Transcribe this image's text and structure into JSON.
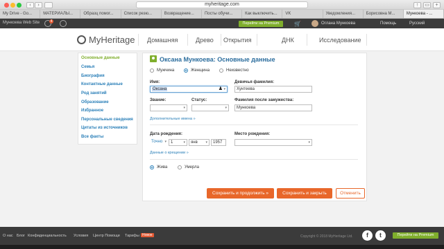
{
  "browser": {
    "url": "myheritage.com",
    "tabs": [
      "My Drive - Go...",
      "МАТЕРИАЛЫ...",
      "Образц помог...",
      "Список резю...",
      "Возвращение...",
      "Посты обучи...",
      "Как выключить...",
      "VK",
      "Уведомления...",
      "Борисовна М...",
      "Мункоева - ..."
    ]
  },
  "topbar": {
    "site_name": "Мункоева Web Site",
    "notif_count": "4",
    "premium_label": "Перейти на Premium",
    "user_name": "Оглана Мункоева",
    "help_label": "Помощь",
    "lang_label": "Русский"
  },
  "nav": {
    "logo": "MyHeritage",
    "items": [
      "Домашняя",
      "Древо",
      "Открытия",
      "ДНК",
      "Исследование"
    ]
  },
  "sidebar": {
    "items": [
      "Основные данные",
      "Семья",
      "Биография",
      "Контактные данные",
      "Род занятий",
      "Образование",
      "Избранное",
      "Персональные сведения",
      "Цитаты из источников",
      "Все факты"
    ]
  },
  "form": {
    "title": "Оксана Мункоева: Основные данные",
    "gender": {
      "male": "Мужчина",
      "female": "Женщина",
      "unknown": "Неизвестно"
    },
    "first_name_label": "Имя:",
    "first_name_value": "Оксана",
    "maiden_name_label": "Девичья фамилия:",
    "maiden_name_value": "Хунтеева",
    "title_label": "Звание:",
    "status_label": "Статус:",
    "married_name_label": "Фамилия после замужества:",
    "married_name_value": "Мункоева",
    "more_names_link": "Дополнительные имена »",
    "birth_date_label": "Дата рождения:",
    "birth_precision": "Точно",
    "birth_day": "1",
    "birth_month": "янв",
    "birth_year": "1957",
    "birth_place_label": "Место рождения:",
    "baptism_link": "Данные о крещении »",
    "alive_label": "Жива",
    "deceased_label": "Умерла",
    "save_continue": "Сохранить и продолжить »",
    "save_close": "Сохранить и закрыть",
    "cancel": "Отменить"
  },
  "footer": {
    "links": [
      "О нас",
      "Блог",
      "Конфиденциальность",
      "Условия",
      "Центр Помощи",
      "Тарифы"
    ],
    "new_badge": "Новое",
    "copyright": "Copyright © 2018 MyHeritage Ltd.",
    "facebook": "f",
    "twitter": "t"
  }
}
